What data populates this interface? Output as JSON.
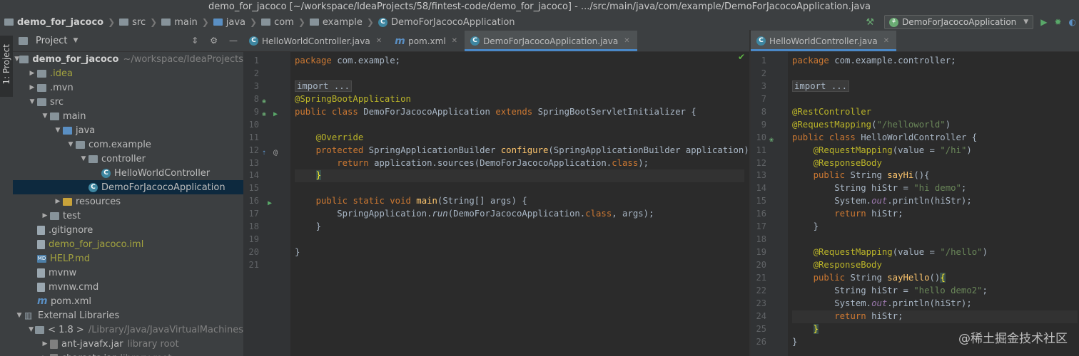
{
  "window": {
    "title": "demo_for_jacoco [~/workspace/IdeaProjects/58/fintest-code/demo_for_jacoco] - .../src/main/java/com/example/DemoForJacocoApplication.java"
  },
  "breadcrumbs": [
    "demo_for_jacoco",
    "src",
    "main",
    "java",
    "com",
    "example",
    "DemoForJacocoApplication"
  ],
  "toolbar": {
    "run_config": "DemoForJacocoApplication"
  },
  "sidebar": {
    "tab_label": "1: Project"
  },
  "project": {
    "title": "Project",
    "tree": [
      {
        "label": "demo_for_jacoco",
        "hint": "~/workspace/IdeaProjects",
        "depth": 0,
        "arrow": "open",
        "icon": "folder-gray",
        "style": "bold"
      },
      {
        "label": ".idea",
        "hint": "",
        "depth": 1,
        "arrow": "closed",
        "icon": "folder-gray",
        "style": "olive"
      },
      {
        "label": ".mvn",
        "hint": "",
        "depth": 1,
        "arrow": "closed",
        "icon": "folder-gray",
        "style": ""
      },
      {
        "label": "src",
        "hint": "",
        "depth": 1,
        "arrow": "open",
        "icon": "folder-gray",
        "style": ""
      },
      {
        "label": "main",
        "hint": "",
        "depth": 2,
        "arrow": "open",
        "icon": "folder-gray",
        "style": ""
      },
      {
        "label": "java",
        "hint": "",
        "depth": 3,
        "arrow": "open",
        "icon": "folder-blue",
        "style": ""
      },
      {
        "label": "com.example",
        "hint": "",
        "depth": 4,
        "arrow": "open",
        "icon": "folder-gray",
        "style": ""
      },
      {
        "label": "controller",
        "hint": "",
        "depth": 5,
        "arrow": "open",
        "icon": "folder-gray",
        "style": ""
      },
      {
        "label": "HelloWorldController",
        "hint": "",
        "depth": 6,
        "arrow": "",
        "icon": "class",
        "style": ""
      },
      {
        "label": "DemoForJacocoApplication",
        "hint": "",
        "depth": 5,
        "arrow": "",
        "icon": "class",
        "style": "selected"
      },
      {
        "label": "resources",
        "hint": "",
        "depth": 3,
        "arrow": "closed",
        "icon": "folder-yellow",
        "style": ""
      },
      {
        "label": "test",
        "hint": "",
        "depth": 2,
        "arrow": "closed",
        "icon": "folder-gray",
        "style": ""
      },
      {
        "label": ".gitignore",
        "hint": "",
        "depth": 1,
        "arrow": "",
        "icon": "file",
        "style": ""
      },
      {
        "label": "demo_for_jacoco.iml",
        "hint": "",
        "depth": 1,
        "arrow": "",
        "icon": "file",
        "style": "olive"
      },
      {
        "label": "HELP.md",
        "hint": "",
        "depth": 1,
        "arrow": "",
        "icon": "md",
        "style": "olive"
      },
      {
        "label": "mvnw",
        "hint": "",
        "depth": 1,
        "arrow": "",
        "icon": "file",
        "style": ""
      },
      {
        "label": "mvnw.cmd",
        "hint": "",
        "depth": 1,
        "arrow": "",
        "icon": "file",
        "style": ""
      },
      {
        "label": "pom.xml",
        "hint": "",
        "depth": 1,
        "arrow": "",
        "icon": "m",
        "style": ""
      },
      {
        "label": "External Libraries",
        "hint": "",
        "depth": 0,
        "arrow": "open",
        "icon": "lib",
        "style": ""
      },
      {
        "label": "< 1.8 >",
        "hint": "/Library/Java/JavaVirtualMachines",
        "depth": 1,
        "arrow": "open",
        "icon": "folder-gray",
        "style": ""
      },
      {
        "label": "ant-javafx.jar",
        "hint": "library root",
        "depth": 2,
        "arrow": "closed",
        "icon": "jar",
        "style": ""
      },
      {
        "label": "charsets.jar",
        "hint": "library root",
        "depth": 2,
        "arrow": "closed",
        "icon": "jar",
        "style": ""
      }
    ]
  },
  "editor_left": {
    "tabs": [
      {
        "label": "HelloWorldController.java",
        "icon": "class",
        "active": false
      },
      {
        "label": "pom.xml",
        "icon": "m",
        "active": false
      },
      {
        "label": "DemoForJacocoApplication.java",
        "icon": "class",
        "active": true
      }
    ],
    "current_line": 14,
    "lines": [
      [
        [
          "kw",
          "package "
        ],
        [
          "",
          "com.example;"
        ]
      ],
      [],
      [
        [
          "fold",
          "import ..."
        ]
      ],
      [],
      [],
      [],
      [],
      [
        [
          "an",
          "@SpringBootApplication"
        ]
      ],
      [
        [
          "kw",
          "public class "
        ],
        [
          "",
          "DemoForJacocoApplication "
        ],
        [
          "kw",
          "extends "
        ],
        [
          "",
          "SpringBootServletInitializer {"
        ]
      ],
      [],
      [
        [
          "",
          "    "
        ],
        [
          "an",
          "@Override"
        ]
      ],
      [
        [
          "",
          "    "
        ],
        [
          "kw",
          "protected "
        ],
        [
          "",
          "SpringApplicationBuilder "
        ],
        [
          "fn",
          "configure"
        ],
        [
          "",
          "(SpringApplicationBuilder application) "
        ],
        [
          "brace",
          "{"
        ]
      ],
      [
        [
          "",
          "        "
        ],
        [
          "kw",
          "return "
        ],
        [
          "",
          "application.sources(DemoForJacocoApplication."
        ],
        [
          "kw",
          "class"
        ],
        [
          "",
          ");"
        ]
      ],
      [
        [
          "",
          "    "
        ],
        [
          "brace",
          "}"
        ]
      ],
      [],
      [
        [
          "",
          "    "
        ],
        [
          "kw",
          "public static void "
        ],
        [
          "fn",
          "main"
        ],
        [
          "",
          "(String[] args) {"
        ]
      ],
      [
        [
          "",
          "        SpringApplication."
        ],
        [
          "kwit",
          "run"
        ],
        [
          "",
          "(DemoForJacocoApplication."
        ],
        [
          "kw",
          "class"
        ],
        [
          "",
          ", args);"
        ]
      ],
      [
        [
          "",
          "    }"
        ]
      ],
      [],
      [
        [
          "",
          "}"
        ]
      ],
      []
    ],
    "line_numbers": [
      1,
      2,
      3,
      8,
      9,
      10,
      11,
      12,
      13,
      14,
      15,
      16,
      17,
      18,
      19,
      20,
      21
    ]
  },
  "editor_right": {
    "tabs": [
      {
        "label": "HelloWorldController.java",
        "icon": "class",
        "active": true
      }
    ],
    "current_line": 24,
    "line_numbers": [
      1,
      2,
      3,
      7,
      8,
      9,
      10,
      11,
      12,
      13,
      14,
      15,
      16,
      17,
      18,
      19,
      20,
      21,
      22,
      23,
      24,
      25,
      26
    ],
    "lines": [
      [
        [
          "kw",
          "package "
        ],
        [
          "",
          "com.example.controller;"
        ]
      ],
      [],
      [
        [
          "fold",
          "import ..."
        ]
      ],
      [],
      [
        [
          "an",
          "@RestController"
        ]
      ],
      [
        [
          "an",
          "@RequestMapping"
        ],
        [
          "",
          "("
        ],
        [
          "str",
          "\"/helloworld\""
        ],
        [
          "",
          ")"
        ]
      ],
      [
        [
          "kw",
          "public class "
        ],
        [
          "",
          "HelloWorldController {"
        ]
      ],
      [
        [
          "",
          "    "
        ],
        [
          "an",
          "@RequestMapping"
        ],
        [
          "",
          "("
        ],
        [
          "",
          "value = "
        ],
        [
          "str",
          "\"/hi\""
        ],
        [
          "",
          ")"
        ]
      ],
      [
        [
          "",
          "    "
        ],
        [
          "an",
          "@ResponseBody"
        ]
      ],
      [
        [
          "",
          "    "
        ],
        [
          "kw",
          "public "
        ],
        [
          "",
          "String "
        ],
        [
          "fn",
          "sayHi"
        ],
        [
          "",
          "(){"
        ]
      ],
      [
        [
          "",
          "        String hiStr = "
        ],
        [
          "str",
          "\"hi demo\""
        ],
        [
          "",
          ";"
        ]
      ],
      [
        [
          "",
          "        System."
        ],
        [
          "it",
          "out"
        ],
        [
          "",
          ".println(hiStr);"
        ]
      ],
      [
        [
          "",
          "        "
        ],
        [
          "kw",
          "return "
        ],
        [
          "",
          "hiStr;"
        ]
      ],
      [
        [
          "",
          "    }"
        ]
      ],
      [],
      [
        [
          "",
          "    "
        ],
        [
          "an",
          "@RequestMapping"
        ],
        [
          "",
          "(value = "
        ],
        [
          "str",
          "\"/hello\""
        ],
        [
          "",
          ")"
        ]
      ],
      [
        [
          "",
          "    "
        ],
        [
          "an",
          "@ResponseBody"
        ]
      ],
      [
        [
          "",
          "    "
        ],
        [
          "kw",
          "public "
        ],
        [
          "",
          "String "
        ],
        [
          "fn",
          "sayHello"
        ],
        [
          "",
          "()"
        ],
        [
          "brace",
          "{"
        ]
      ],
      [
        [
          "",
          "        String hiStr = "
        ],
        [
          "str",
          "\"hello demo2\""
        ],
        [
          "",
          ";"
        ]
      ],
      [
        [
          "",
          "        System."
        ],
        [
          "it",
          "out"
        ],
        [
          "",
          ".println(hiStr);"
        ]
      ],
      [
        [
          "",
          "        "
        ],
        [
          "kw",
          "return "
        ],
        [
          "",
          "hiStr;"
        ]
      ],
      [
        [
          "",
          "    "
        ],
        [
          "brace",
          "}"
        ]
      ],
      [
        [
          "",
          "}"
        ]
      ],
      []
    ]
  },
  "watermark": "@稀土掘金技术社区"
}
